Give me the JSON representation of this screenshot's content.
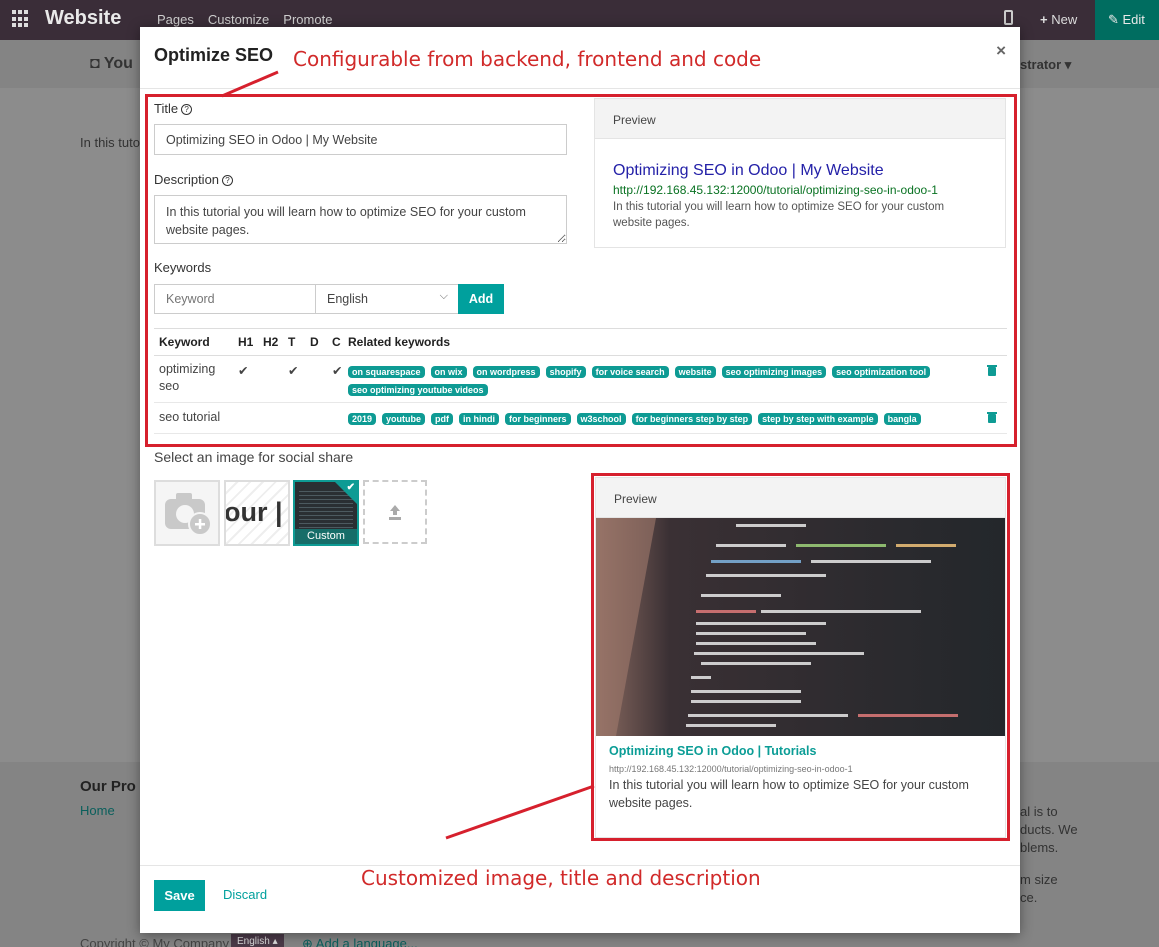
{
  "navbar": {
    "brand": "Website",
    "menu": [
      "Pages",
      "Customize",
      "Promote"
    ],
    "new_label": "New",
    "edit_label": "Edit"
  },
  "background": {
    "header_text": "You",
    "body_text": "In this tuto",
    "user_menu": "strator",
    "footer_heading": "Our Pro",
    "footer_link": "Home",
    "right_lines": [
      "al is to",
      "ducts. We",
      "blems.",
      "m size",
      "ce."
    ],
    "copyright": "Copyright © My Company",
    "lang_badge": "English",
    "add_language": "Add a language..."
  },
  "modal": {
    "title": "Optimize SEO",
    "close": "×",
    "title_label": "Title",
    "title_value": "Optimizing SEO in Odoo | My Website",
    "description_label": "Description",
    "description_value": "In this tutorial you will learn how to optimize SEO for your custom website pages.",
    "keywords_label": "Keywords",
    "keyword_placeholder": "Keyword",
    "language_selected": "English",
    "add_label": "Add",
    "preview_label": "Preview",
    "google_preview": {
      "title": "Optimizing SEO in Odoo | My Website",
      "url": "http://192.168.45.132:12000/tutorial/optimizing-seo-in-odoo-1",
      "description": "In this tutorial you will learn how to optimize SEO for your custom website pages."
    },
    "table_headers": [
      "Keyword",
      "H1",
      "H2",
      "T",
      "D",
      "C",
      "Related keywords"
    ],
    "keyword_rows": [
      {
        "keyword": "optimizing seo",
        "h1": "✔",
        "h2": "",
        "t": "✔",
        "d": "",
        "c": "✔",
        "related": [
          "on squarespace",
          "on wix",
          "on wordpress",
          "shopify",
          "for voice search",
          "website",
          "seo optimizing images",
          "seo optimization tool",
          "seo optimizing youtube videos"
        ]
      },
      {
        "keyword": "seo tutorial",
        "h1": "",
        "h2": "",
        "t": "",
        "d": "",
        "c": "",
        "related": [
          "2019",
          "youtube",
          "pdf",
          "in hindi",
          "for beginners",
          "w3school",
          "for beginners step by step",
          "step by step with example",
          "bangla"
        ]
      }
    ],
    "social_label": "Select an image for social share",
    "thumb_logo_text": "our |",
    "thumb_custom_label": "Custom",
    "social_preview": {
      "label": "Preview",
      "title": "Optimizing SEO in Odoo | Tutorials",
      "url": "http://192.168.45.132:12000/tutorial/optimizing-seo-in-odoo-1",
      "description": "In this tutorial you will learn how to optimize SEO for your custom website pages."
    },
    "save_label": "Save",
    "discard_label": "Discard"
  },
  "annotations": {
    "top": "Configurable from backend, frontend and code",
    "bottom": "Customized image, title and description"
  },
  "colors": {
    "navbar": "#3a2d38",
    "accent": "#00a09d",
    "badge": "#0e9b94",
    "annotation": "#d6202d",
    "google_title": "#2421a8",
    "google_url": "#097222"
  }
}
